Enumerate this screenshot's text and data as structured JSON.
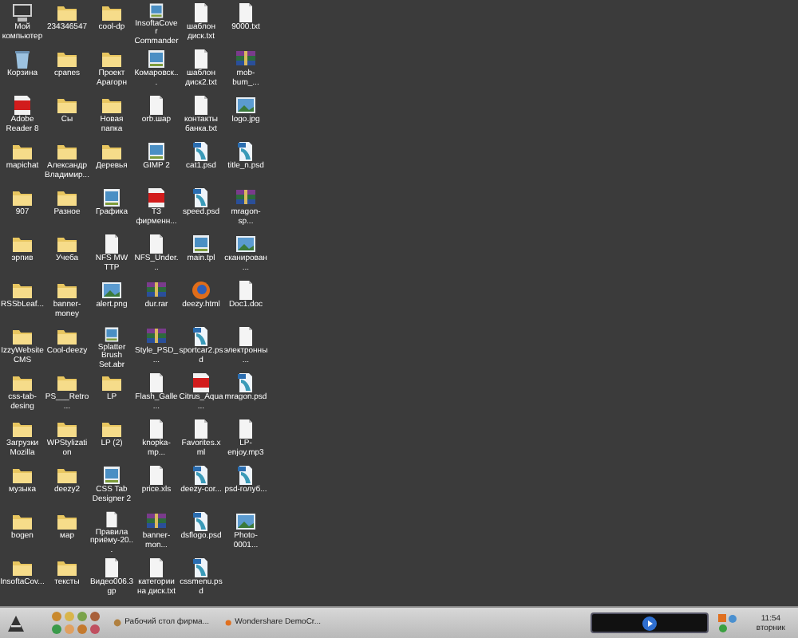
{
  "desktop": {
    "icons": [
      {
        "label": "Мой компьютер",
        "kind": "computer"
      },
      {
        "label": "Корзина",
        "kind": "trash"
      },
      {
        "label": "Adobe Reader 8",
        "kind": "pdf"
      },
      {
        "label": "mapichat",
        "kind": "folder"
      },
      {
        "label": "907",
        "kind": "folder"
      },
      {
        "label": "эрпив",
        "kind": "folder"
      },
      {
        "label": "RSSbLeaf...",
        "kind": "folder"
      },
      {
        "label": "IzzyWebsite CMS",
        "kind": "folder"
      },
      {
        "label": "css-tab-desing",
        "kind": "folder"
      },
      {
        "label": "Загрузки Mozilla",
        "kind": "folder"
      },
      {
        "label": "музыка",
        "kind": "folder"
      },
      {
        "label": "bogen",
        "kind": "folder"
      },
      {
        "label": "InsoftaCov...",
        "kind": "folder"
      },
      {
        "label": "234346547",
        "kind": "folder"
      },
      {
        "label": "cpanes",
        "kind": "folder"
      },
      {
        "label": "Сы",
        "kind": "folder"
      },
      {
        "label": "Александр Владимир...",
        "kind": "folder"
      },
      {
        "label": "Разное",
        "kind": "folder"
      },
      {
        "label": "Учеба",
        "kind": "folder"
      },
      {
        "label": "banner-money",
        "kind": "folder"
      },
      {
        "label": "Cool-deezy",
        "kind": "folder"
      },
      {
        "label": "PS___Retro...",
        "kind": "folder"
      },
      {
        "label": "WPStylization",
        "kind": "folder"
      },
      {
        "label": "deezy2",
        "kind": "folder"
      },
      {
        "label": "мар",
        "kind": "folder"
      },
      {
        "label": "тексты",
        "kind": "folder"
      },
      {
        "label": "cool-dp",
        "kind": "folder"
      },
      {
        "label": "Проект Арагорн",
        "kind": "folder"
      },
      {
        "label": "Новая папка",
        "kind": "folder"
      },
      {
        "label": "Деревья",
        "kind": "folder"
      },
      {
        "label": "Графика",
        "kind": "app"
      },
      {
        "label": "NFS MW TTP",
        "kind": "doc"
      },
      {
        "label": "alert.png",
        "kind": "image"
      },
      {
        "label": "Splatter Brush Set.abr",
        "kind": "app"
      },
      {
        "label": "LP",
        "kind": "folder"
      },
      {
        "label": "LP (2)",
        "kind": "folder"
      },
      {
        "label": "CSS Tab Designer 2",
        "kind": "app"
      },
      {
        "label": "Правила приёму-20...",
        "kind": "doc"
      },
      {
        "label": "Видео006.3gp",
        "kind": "doc"
      },
      {
        "label": "InsoftaCover Commander",
        "kind": "app"
      },
      {
        "label": "Комаровск...",
        "kind": "app"
      },
      {
        "label": "orb.шар",
        "kind": "doc"
      },
      {
        "label": "GIMP 2",
        "kind": "app"
      },
      {
        "label": "ТЗ фирменн...",
        "kind": "pdf"
      },
      {
        "label": "NFS_Under...",
        "kind": "doc"
      },
      {
        "label": "dur.rar",
        "kind": "rar"
      },
      {
        "label": "Style_PSD_...",
        "kind": "rar"
      },
      {
        "label": "Flash_Galle...",
        "kind": "doc"
      },
      {
        "label": "knopka-mp...",
        "kind": "doc"
      },
      {
        "label": "price.xls",
        "kind": "doc"
      },
      {
        "label": "banner-mon...",
        "kind": "rar"
      },
      {
        "label": "категории на диск.txt",
        "kind": "doc"
      },
      {
        "label": "шаблон диск.txt",
        "kind": "doc"
      },
      {
        "label": "шаблон диск2.txt",
        "kind": "doc"
      },
      {
        "label": "контакты банка.txt",
        "kind": "doc"
      },
      {
        "label": "cat1.psd",
        "kind": "psd"
      },
      {
        "label": "speed.psd",
        "kind": "psd"
      },
      {
        "label": "main.tpl",
        "kind": "app"
      },
      {
        "label": "deezy.html",
        "kind": "html"
      },
      {
        "label": "sportcar2.psd",
        "kind": "psd"
      },
      {
        "label": "Citrus_Aqua...",
        "kind": "pdf"
      },
      {
        "label": "Favorites.xml",
        "kind": "doc"
      },
      {
        "label": "deezy-cor...",
        "kind": "psd"
      },
      {
        "label": "dsflogo.psd",
        "kind": "psd"
      },
      {
        "label": "cssmenu.psd",
        "kind": "psd"
      },
      {
        "label": "9000.txt",
        "kind": "doc"
      },
      {
        "label": "mob-bum_...",
        "kind": "rar"
      },
      {
        "label": "logo.jpg",
        "kind": "image"
      },
      {
        "label": "title_n.psd",
        "kind": "psd"
      },
      {
        "label": "mragon-sp...",
        "kind": "rar"
      },
      {
        "label": "сканирован...",
        "kind": "image"
      },
      {
        "label": "Doc1.doc",
        "kind": "doc"
      },
      {
        "label": "электронны...",
        "kind": "doc"
      },
      {
        "label": "mragon.psd",
        "kind": "psd"
      },
      {
        "label": "LP-enjoy.mp3",
        "kind": "doc"
      },
      {
        "label": "psd-голуб...",
        "kind": "psd"
      },
      {
        "label": "Photo-0001...",
        "kind": "image"
      }
    ]
  },
  "taskbar": {
    "tasks": [
      {
        "label": "Рабочий стол фирма...",
        "selected": false
      },
      {
        "label": "Wondershare DemoCr...",
        "selected": false
      }
    ],
    "clock": {
      "time": "11:54",
      "day": "вторник"
    }
  }
}
